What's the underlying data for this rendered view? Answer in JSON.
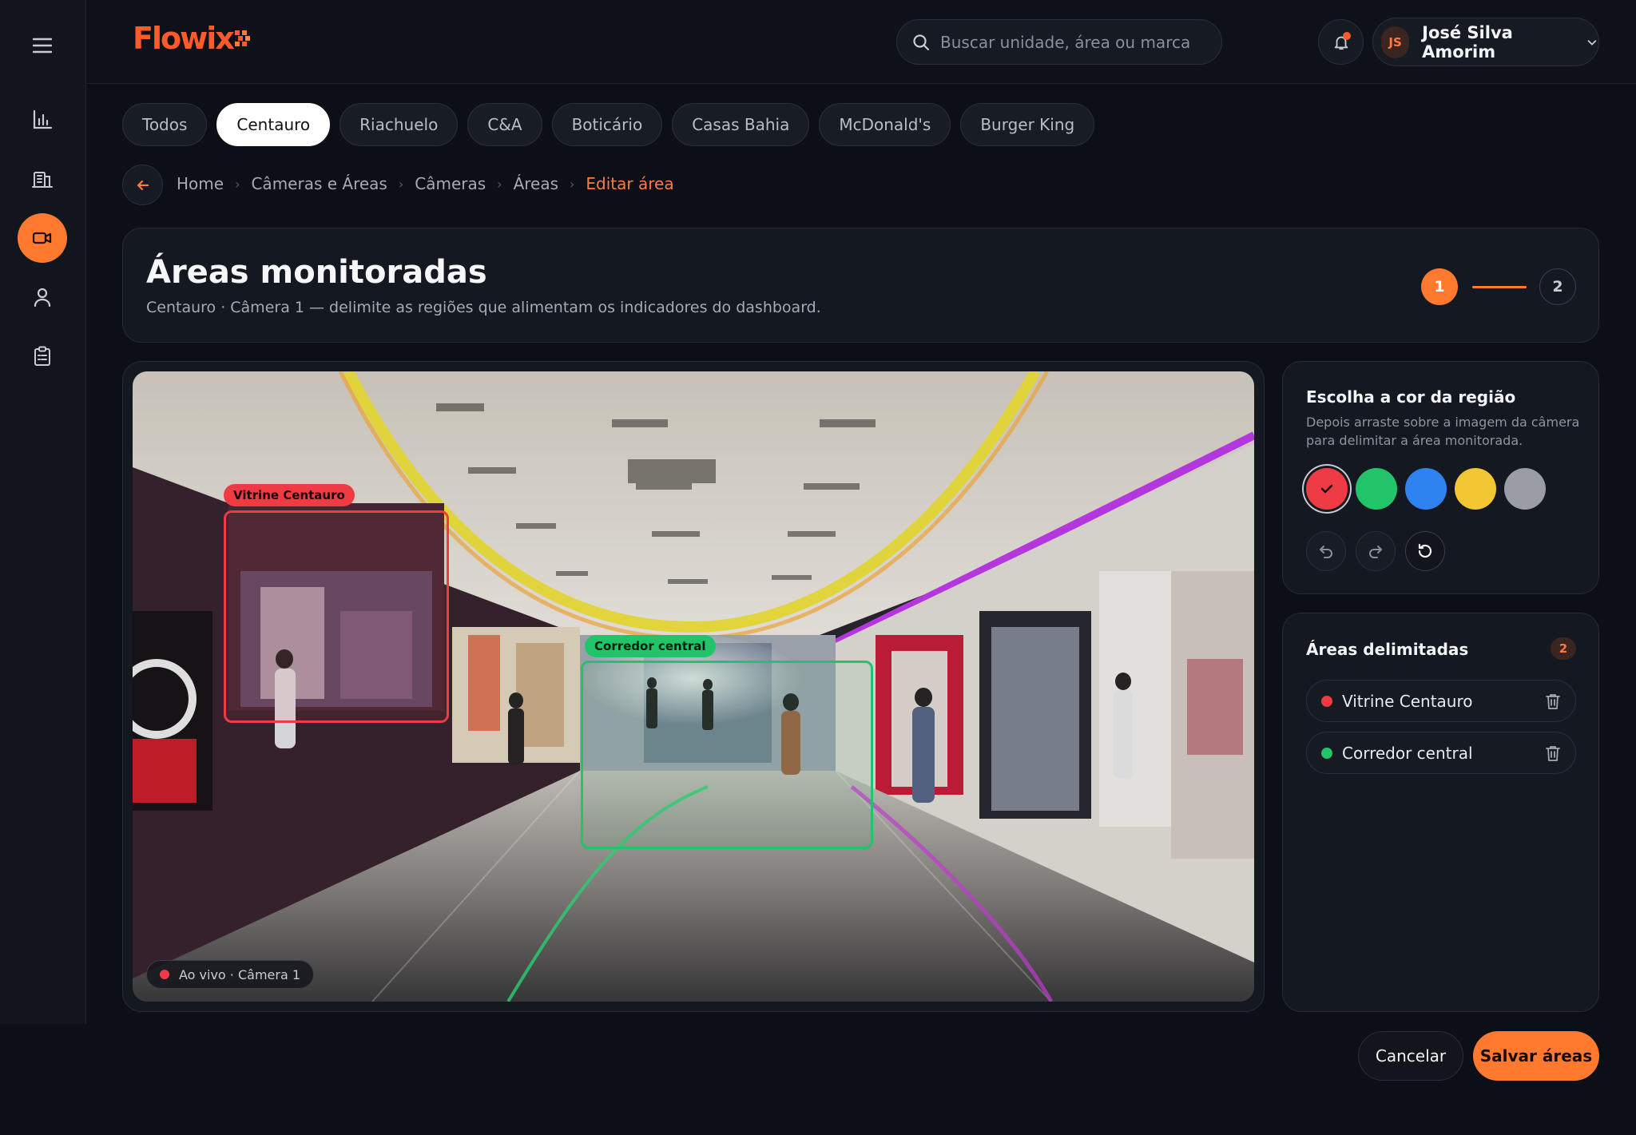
{
  "app": {
    "logo_text": "Flowix",
    "brand_color": "#ff5a2c",
    "accent_color": "#ff7a2f"
  },
  "sidebar": {
    "items": [
      {
        "icon": "menu-icon",
        "active": false
      },
      {
        "icon": "bar-chart-icon",
        "active": false
      },
      {
        "icon": "building-icon",
        "active": false
      },
      {
        "icon": "video-camera-icon",
        "active": true
      },
      {
        "icon": "user-icon",
        "active": false
      },
      {
        "icon": "clipboard-icon",
        "active": false
      }
    ]
  },
  "header": {
    "search": {
      "placeholder": "Buscar unidade, área ou marca",
      "value": ""
    },
    "notifications": {
      "has_unread": true
    },
    "user": {
      "initials": "JS",
      "name": "José Silva Amorim"
    }
  },
  "brand_tabs": {
    "items": [
      {
        "label": "Todos",
        "active": false
      },
      {
        "label": "Centauro",
        "active": true
      },
      {
        "label": "Riachuelo",
        "active": false
      },
      {
        "label": "C&A",
        "active": false
      },
      {
        "label": "Boticário",
        "active": false
      },
      {
        "label": "Casas Bahia",
        "active": false
      },
      {
        "label": "McDonald's",
        "active": false
      },
      {
        "label": "Burger King",
        "active": false
      }
    ]
  },
  "breadcrumb": {
    "items": [
      "Home",
      "Câmeras e Áreas",
      "Câmeras",
      "Áreas"
    ],
    "current": "Editar área"
  },
  "page": {
    "title": "Áreas monitoradas",
    "subtitle": "Centauro · Câmera 1 — delimite as regiões que alimentam os indicadores do dashboard.",
    "steps": {
      "current": "1",
      "next": "2"
    }
  },
  "camera": {
    "live_label": "Ao vivo · Câmera 1",
    "regions": [
      {
        "label": "Vitrine Centauro",
        "color": "#ef3b43"
      },
      {
        "label": "Corredor central",
        "color": "#22c46a"
      }
    ]
  },
  "color_picker": {
    "title": "Escolha a cor da região",
    "description": "Depois arraste sobre a imagem da câmera para delimitar a área monitorada.",
    "swatches": [
      {
        "name": "red",
        "hex": "#ef3b43",
        "selected": true
      },
      {
        "name": "green",
        "hex": "#22c46a",
        "selected": false
      },
      {
        "name": "blue",
        "hex": "#2f83f0",
        "selected": false
      },
      {
        "name": "yellow",
        "hex": "#f2c733",
        "selected": false
      },
      {
        "name": "gray",
        "hex": "#9a9da3",
        "selected": false
      }
    ],
    "tools": [
      "undo-icon",
      "redo-icon",
      "reset-icon"
    ]
  },
  "areas": {
    "title": "Áreas delimitadas",
    "count": "2",
    "items": [
      {
        "label": "Vitrine Centauro",
        "color": "#ef3b43"
      },
      {
        "label": "Corredor central",
        "color": "#22c46a"
      }
    ]
  },
  "actions": {
    "cancel_label": "Cancelar",
    "save_label": "Salvar áreas"
  }
}
